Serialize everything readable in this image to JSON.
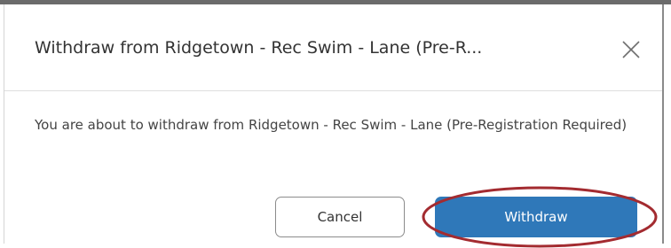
{
  "dialog": {
    "title": "Withdraw from Ridgetown - Rec Swim - Lane (Pre-R...",
    "close_icon": "close-icon",
    "message": "You are about to withdraw from Ridgetown - Rec Swim - Lane (Pre-Registration Required)",
    "cancel_label": "Cancel",
    "withdraw_label": "Withdraw"
  },
  "colors": {
    "primary_button": "#2f78b9",
    "highlight_ring": "#a32b30"
  }
}
